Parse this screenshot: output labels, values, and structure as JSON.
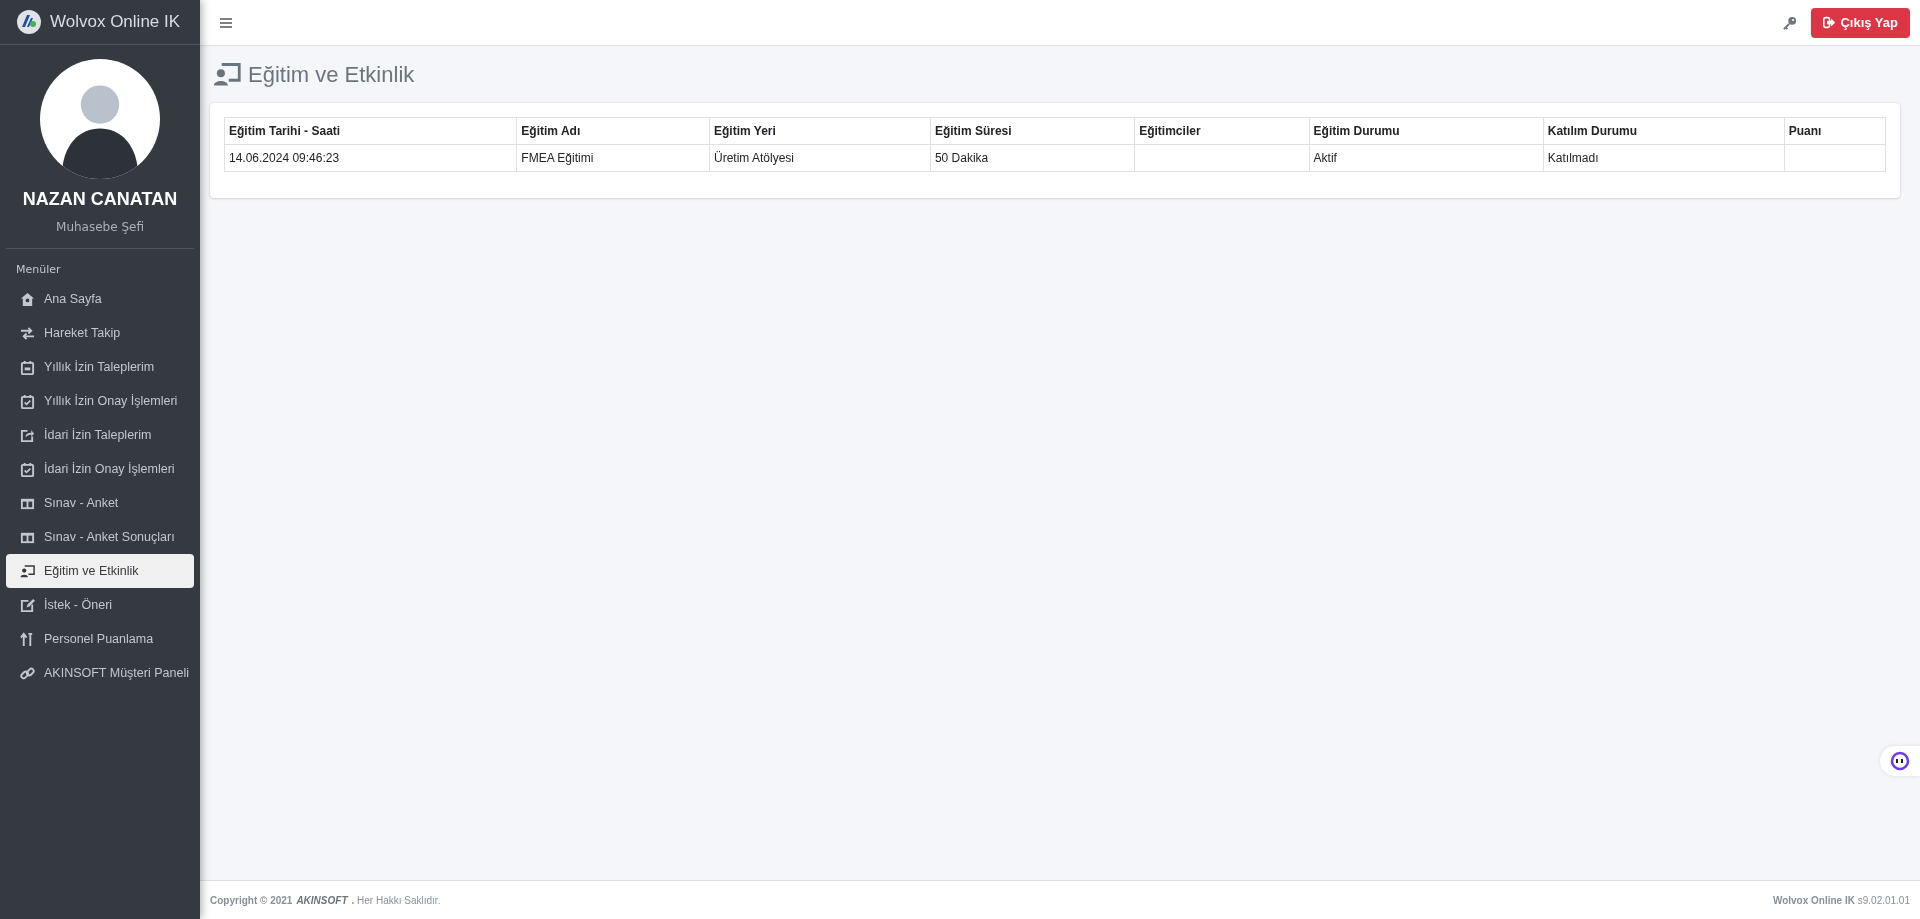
{
  "brand": {
    "title": "Wolvox Online IK"
  },
  "profile": {
    "name": "NAZAN CANATAN",
    "role": "Muhasebe Şefi"
  },
  "menu": {
    "heading": "Menüler",
    "items": [
      {
        "label": "Ana Sayfa",
        "selected": false
      },
      {
        "label": "Hareket Takip",
        "selected": false
      },
      {
        "label": "Yıllık İzin Taleplerim",
        "selected": false
      },
      {
        "label": "Yıllık İzin Onay İşlemleri",
        "selected": false
      },
      {
        "label": "İdari İzin Taleplerim",
        "selected": false
      },
      {
        "label": "İdari İzin Onay İşlemleri",
        "selected": false
      },
      {
        "label": "Sınav - Anket",
        "selected": false
      },
      {
        "label": "Sınav - Anket Sonuçları",
        "selected": false
      },
      {
        "label": "Eğitim ve Etkinlik",
        "selected": true
      },
      {
        "label": "İstek - Öneri",
        "selected": false
      },
      {
        "label": "Personel Puanlama",
        "selected": false
      },
      {
        "label": "AKINSOFT Müşteri Paneli",
        "selected": false
      }
    ]
  },
  "topbar": {
    "logout": "Çıkış Yap"
  },
  "page": {
    "title": "Eğitim ve Etkinlik"
  },
  "table": {
    "columns": [
      "Eğitim Tarihi - Saati",
      "Eğitim Adı",
      "Eğitim Yeri",
      "Eğitim Süresi",
      "Eğitimciler",
      "Eğitim Durumu",
      "Katılım Durumu",
      "Puanı"
    ],
    "rows": [
      [
        "14.06.2024 09:46:23",
        "FMEA Eğitimi",
        "Üretim Atölyesi",
        "50 Dakika",
        "",
        "Aktif",
        "Katılmadı",
        ""
      ]
    ]
  },
  "footer": {
    "copyright": "Copyright © 2021",
    "brand": "AKINSOFT",
    "rights": "**.** Her Hakkı Saklıdır.",
    "version": "**Wolvox Online IK** s9.02.01.01"
  }
}
